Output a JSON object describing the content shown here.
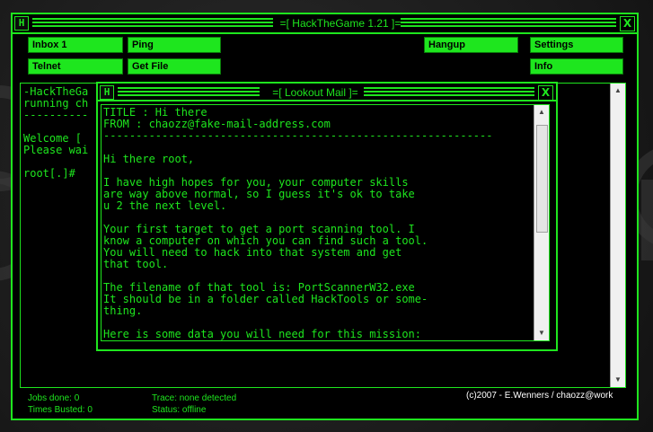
{
  "app": {
    "title": "=[ HackTheGame 1.21 ]=",
    "icon_letter": "H",
    "close_label": "X",
    "accent_color": "#1ee61e"
  },
  "toolbar": {
    "inbox_label": "Inbox 1",
    "ping_label": "Ping",
    "hangup_label": "Hangup",
    "settings_label": "Settings",
    "telnet_label": "Telnet",
    "get_file_label": "Get File",
    "info_label": "Info"
  },
  "console": {
    "lines": [
      "-HackTheGa",
      "running ch",
      "----------",
      "",
      "Welcome [",
      "Please wai",
      "",
      "root[.]#"
    ]
  },
  "status": {
    "jobs_done": "Jobs done: 0",
    "times_busted": "Times Busted: 0",
    "trace": "Trace: none detected",
    "status": "Status: offline",
    "copyright": "(c)2007 - E.Wenners / chaozz@work"
  },
  "mail": {
    "title": "=[ Lookout Mail ]=",
    "icon_letter": "H",
    "close_label": "X",
    "lines": [
      "TITLE : Hi there",
      "FROM : chaozz@fake-mail-address.com",
      "------------------------------------------------------------",
      "",
      "Hi there root,",
      "",
      "I have high hopes for you, your computer skills",
      "are way above normal, so I guess it's ok to take",
      "u 2 the next level.",
      "",
      "Your first target to get a port scanning tool. I",
      "know a computer on which you can find such a tool.",
      "You will need to hack into that system and get",
      "that tool.",
      "",
      "The filename of that tool is: PortScannerW32.exe",
      "It should be in a folder called HackTools or some-",
      "thing.",
      "",
      "Here is some data you will need for this mission:"
    ]
  }
}
